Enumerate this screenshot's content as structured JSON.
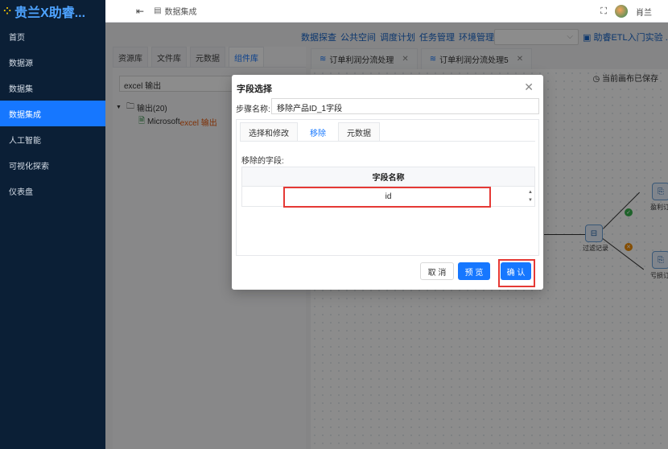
{
  "app": {
    "brand": "贵兰X助睿...",
    "brand_logo": "⁘"
  },
  "sidebar": {
    "items": [
      {
        "label": "首页"
      },
      {
        "label": "数据源"
      },
      {
        "label": "数据集"
      },
      {
        "label": "数据集成",
        "active": true
      },
      {
        "label": "人工智能"
      },
      {
        "label": "可视化探索"
      },
      {
        "label": "仪表盘"
      }
    ]
  },
  "header": {
    "breadcrumb": "数据集成",
    "user": "肖兰"
  },
  "toplinks": {
    "items": [
      "数据探查",
      "公共空间",
      "调度计划",
      "任务管理",
      "环境管理"
    ],
    "guide": "助睿ETL入门实验 ..."
  },
  "left_panel": {
    "tabs": [
      "资源库",
      "文件库",
      "元数据",
      "组件库"
    ],
    "search_value": "excel 输出",
    "tree": {
      "folder": "输出(20)",
      "child_prefix": "Microsoft ",
      "child_keyword": "excel 输出"
    }
  },
  "workspace": {
    "tabs": [
      {
        "label": "订单利润分流处理"
      },
      {
        "label": "订单利润分流处理5"
      }
    ],
    "saved_status": "当前画布已保存",
    "nodes": [
      {
        "label": "过滤记录"
      },
      {
        "label": "盈利订"
      },
      {
        "label": "亏损订"
      }
    ]
  },
  "modal": {
    "title": "字段选择",
    "step_label": "步骤名称:",
    "step_value": "移除产品ID_1字段",
    "tabs": [
      {
        "label": "选择和修改"
      },
      {
        "label": "移除",
        "active": true
      },
      {
        "label": "元数据"
      }
    ],
    "removed_label": "移除的字段:",
    "column_header": "字段名称",
    "rows": [
      {
        "value": "id"
      }
    ],
    "buttons": {
      "cancel": "取 消",
      "preview": "预 览",
      "confirm": "确 认"
    }
  },
  "colors": {
    "accent": "#1677ff",
    "sidebar_bg": "#0b1f36",
    "highlight": "#e53935"
  }
}
